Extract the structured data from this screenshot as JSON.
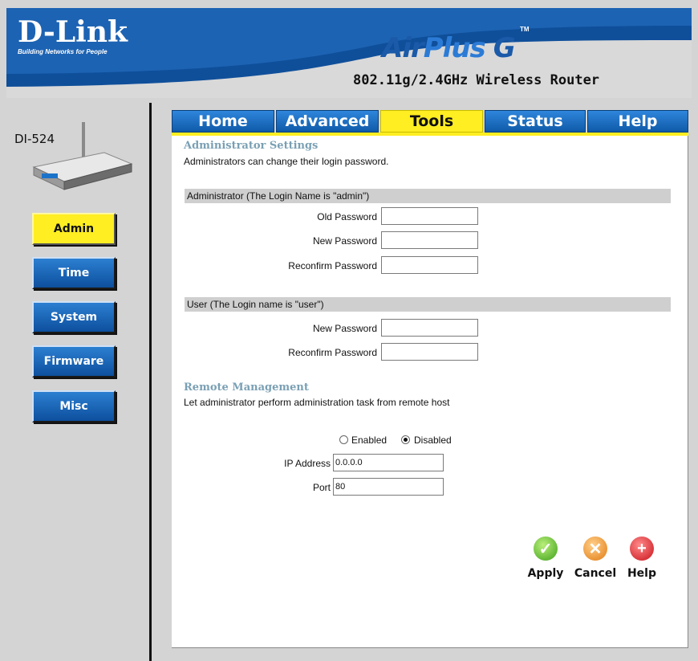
{
  "header": {
    "brand": "D-Link",
    "tagline": "Building Networks for People",
    "product_air": "Air",
    "product_plus": "Plus",
    "product_g": "G",
    "tm": "TM",
    "model_desc": "802.11g/2.4GHz Wireless Router"
  },
  "sidebar": {
    "device_label": "DI-524",
    "items": [
      {
        "label": "Admin",
        "active": true
      },
      {
        "label": "Time"
      },
      {
        "label": "System"
      },
      {
        "label": "Firmware"
      },
      {
        "label": "Misc"
      }
    ]
  },
  "tabs": [
    {
      "label": "Home"
    },
    {
      "label": "Advanced"
    },
    {
      "label": "Tools",
      "active": true
    },
    {
      "label": "Status"
    },
    {
      "label": "Help"
    }
  ],
  "admin_settings": {
    "title": "Administrator Settings",
    "description": "Administrators can change their login password.",
    "admin_bar": "Administrator (The Login Name is \"admin\")",
    "old_password_label": "Old Password",
    "new_password_label": "New Password",
    "reconfirm_password_label": "Reconfirm Password",
    "user_bar": "User (The Login name is \"user\")",
    "user_new_password_label": "New Password",
    "user_reconfirm_password_label": "Reconfirm Password"
  },
  "remote": {
    "title": "Remote Management",
    "description": "Let administrator perform administration task from remote host",
    "enabled_label": "Enabled",
    "disabled_label": "Disabled",
    "ip_label": "IP Address",
    "ip_value": "0.0.0.0",
    "port_label": "Port",
    "port_value": "80"
  },
  "actions": {
    "apply": "Apply",
    "cancel": "Cancel",
    "help": "Help"
  },
  "colors": {
    "header_blue": "#0f4f9a",
    "tab_active": "#ffee22",
    "section_title": "#7aa0b4"
  }
}
